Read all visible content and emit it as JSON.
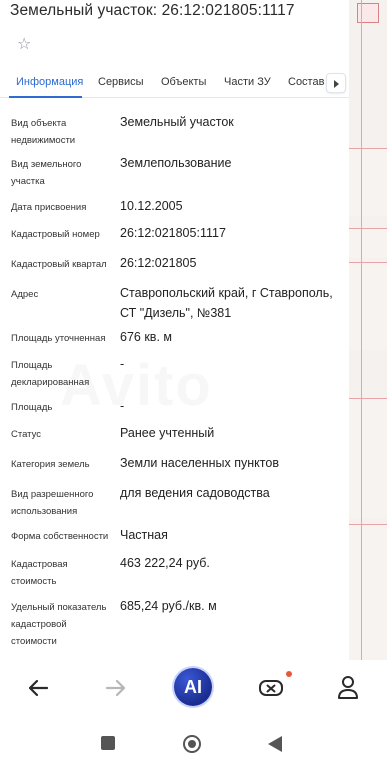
{
  "header": {
    "title": "Земельный участок: 26:12:021805:1117",
    "favorite_icon": "star-outline-icon"
  },
  "tabs": [
    {
      "label": "Информация",
      "active": true
    },
    {
      "label": "Сервисы",
      "active": false
    },
    {
      "label": "Объекты",
      "active": false
    },
    {
      "label": "Части ЗУ",
      "active": false
    },
    {
      "label": "Состав Е",
      "active": false
    }
  ],
  "details": [
    {
      "label": "Вид объекта недвижимости",
      "value": "Земельный участок"
    },
    {
      "label": "Вид земельного участка",
      "value": "Землепользование"
    },
    {
      "label": "Дата присвоения",
      "value": "10.12.2005"
    },
    {
      "label": "Кадастровый номер",
      "value": "26:12:021805:1117"
    },
    {
      "label": "Кадастровый квартал",
      "value": "26:12:021805"
    },
    {
      "label": "Адрес",
      "value": "Ставропольский край, г Ставрополь, СТ \"Дизель\", №381"
    },
    {
      "label": "Площадь уточненная",
      "value": "676 кв. м"
    },
    {
      "label": "Площадь декларированная",
      "value": "-"
    },
    {
      "label": "Площадь",
      "value": "-"
    },
    {
      "label": "Статус",
      "value": "Ранее учтенный"
    },
    {
      "label": "Категория земель",
      "value": "Земли населенных пунктов"
    },
    {
      "label": "Вид разрешенного использования",
      "value": "для ведения садоводства"
    },
    {
      "label": "Форма собственности",
      "value": "Частная"
    },
    {
      "label": "Кадастровая стоимость",
      "value": "463 222,24 руб."
    },
    {
      "label": "Удельный показатель кадастровой стоимости",
      "value": "685,24 руб./кв. м"
    }
  ],
  "bottom_nav": {
    "ai_label": "AI",
    "icons": [
      "arrow-left-icon",
      "arrow-right-icon",
      "ai-assistant-icon",
      "gamepad-icon",
      "profile-icon"
    ]
  },
  "system_nav": {
    "icons": [
      "recents-square-icon",
      "home-circle-icon",
      "back-triangle-icon"
    ]
  },
  "colors": {
    "accent": "#2e6bd3",
    "map_outline": "#e8a3a8",
    "notification_dot": "#e8583a"
  }
}
